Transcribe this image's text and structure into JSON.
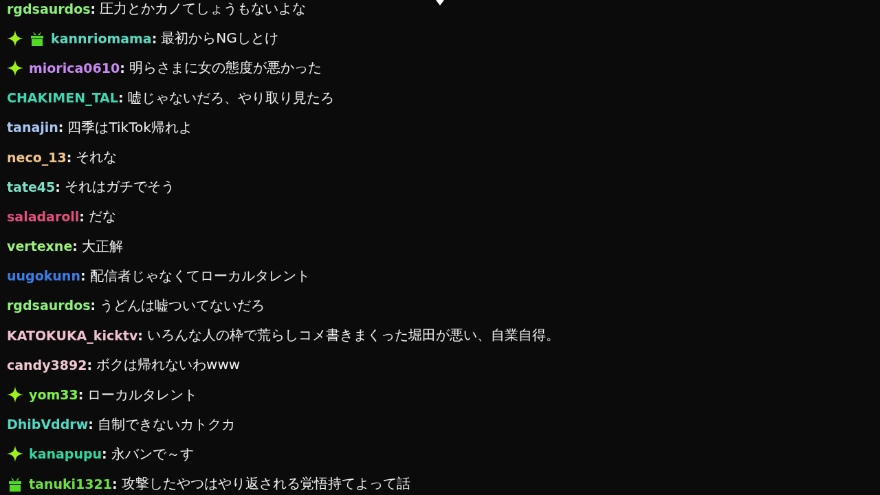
{
  "messages": [
    {
      "username": "rgdsaurdos",
      "separator": ":",
      "color": "#8ef07a",
      "text": "圧力とかカノてしょうもないよな"
    },
    {
      "badges": [
        {
          "kind": "sparkle"
        },
        {
          "kind": "gift"
        }
      ],
      "username": "kannriomama",
      "separator": ":",
      "color": "#5cd8c0",
      "text": "最初からNGしとけ"
    },
    {
      "badges": [
        {
          "kind": "sparkle"
        }
      ],
      "username": "miorica0610",
      "separator": ":",
      "color": "#c88af0",
      "text": "明らさまに女の態度が悪かった"
    },
    {
      "username": "CHAKIMEN_TAL",
      "separator": ":",
      "color": "#3fd6b0",
      "text": "嘘じゃないだろ、やり取り見たろ"
    },
    {
      "username": "tanajin",
      "separator": ":",
      "color": "#a8c4f0",
      "text": "四季はTikTok帰れよ"
    },
    {
      "username": "neco_13",
      "separator": ":",
      "color": "#f2c48a",
      "text": "それな"
    },
    {
      "username": "tate45",
      "separator": ":",
      "color": "#7ce0c8",
      "text": "それはガチでそう"
    },
    {
      "username": "saladaroll",
      "separator": ":",
      "color": "#e0507a",
      "text": "だな"
    },
    {
      "username": "vertexne",
      "separator": ":",
      "color": "#9cf07a",
      "text": "大正解"
    },
    {
      "username": "uugokunn",
      "separator": ":",
      "color": "#3a7ee8",
      "text": "配信者じゃなくてローカルタレント"
    },
    {
      "username": "rgdsaurdos",
      "separator": ":",
      "color": "#8ef07a",
      "text": "うどんは嘘ついてないだろ"
    },
    {
      "username": "KATOKUKA_kicktv",
      "separator": ":",
      "color": "#f0c0cc",
      "text": "いろんな人の枠で荒らしコメ書きまくった堀田が悪い、自業自得。"
    },
    {
      "username": "candy3892",
      "separator": ":",
      "color": "#f0c8d0",
      "text": "ボクは帰れないわwww"
    },
    {
      "badges": [
        {
          "kind": "sparkle"
        }
      ],
      "username": "yom33",
      "separator": ":",
      "color": "#7ef04a",
      "text": "ローカルタレント"
    },
    {
      "username": "DhibVddrw",
      "separator": ":",
      "color": "#50d8c0",
      "text": "自制できないカトクカ"
    },
    {
      "badges": [
        {
          "kind": "sparkle"
        }
      ],
      "username": "kanapupu",
      "separator": ":",
      "color": "#30d8a0",
      "text": "永バンで～す"
    },
    {
      "badges": [
        {
          "kind": "gift"
        }
      ],
      "username": "tanuki1321",
      "separator": ":",
      "color": "#6ee040",
      "text": "攻撃したやつはやり返される覚悟持てよって話"
    }
  ]
}
